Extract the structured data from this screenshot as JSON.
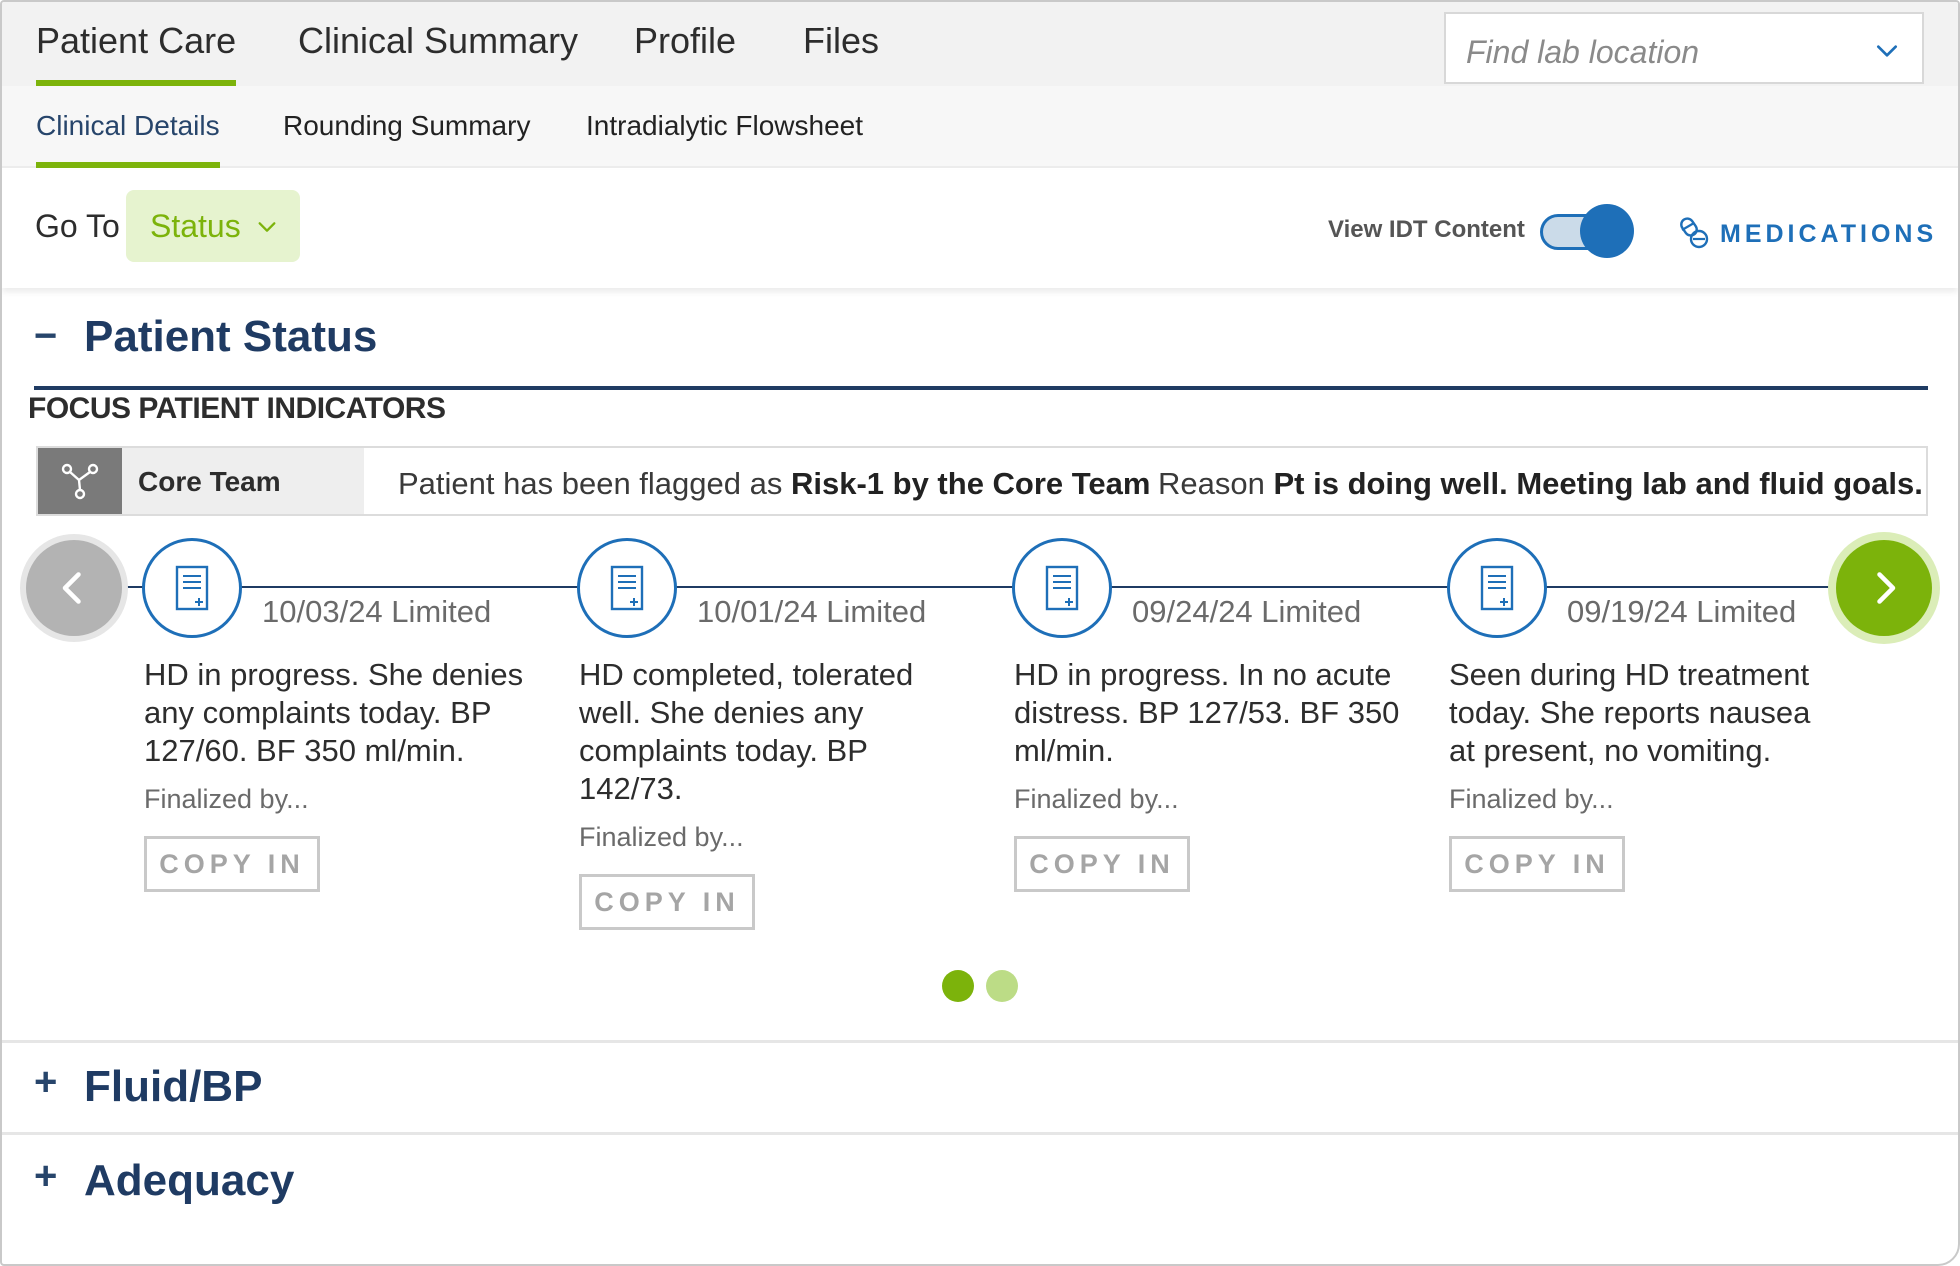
{
  "top_tabs": [
    "Patient Care",
    "Clinical Summary",
    "Profile",
    "Files"
  ],
  "lab_select": {
    "placeholder": "Find lab location"
  },
  "sub_tabs": [
    "Clinical Details",
    "Rounding Summary",
    "Intradialytic Flowsheet"
  ],
  "goto": {
    "label": "Go To",
    "selected": "Status"
  },
  "idt": {
    "label": "View IDT Content",
    "enabled": true
  },
  "medications": {
    "label": "MEDICATIONS"
  },
  "patient_status": {
    "sign": "−",
    "title": "Patient Status",
    "focus_title": "FOCUS PATIENT INDICATORS",
    "core_team": {
      "label": "Core Team",
      "msg_prefix": "Patient has been flagged as",
      "risk": "Risk-1 by the Core Team",
      "reason_label": "Reason",
      "reason": "Pt is doing well. Meeting lab and fluid goals."
    },
    "notes": [
      {
        "date": "10/03/24 Limited",
        "text": "HD in progress. She denies any complaints today. BP 127/60. BF 350 ml/min.",
        "finalized": "Finalized by...",
        "copy": "COPY IN"
      },
      {
        "date": "10/01/24 Limited",
        "text": "HD completed, tolerated well. She denies any complaints today. BP 142/73.",
        "finalized": "Finalized by...",
        "copy": "COPY IN"
      },
      {
        "date": "09/24/24 Limited",
        "text": "HD in progress. In no acute distress. BP 127/53. BF 350 ml/min.",
        "finalized": "Finalized by...",
        "copy": "COPY IN"
      },
      {
        "date": "09/19/24 Limited",
        "text": "Seen during HD treatment today. She reports nausea at present, no vomiting.",
        "finalized": "Finalized by...",
        "copy": "COPY IN"
      }
    ],
    "pagination": {
      "current": 1,
      "total": 2
    }
  },
  "sections": [
    {
      "sign": "+",
      "title": "Fluid/BP"
    },
    {
      "sign": "+",
      "title": "Adequacy"
    }
  ],
  "colors": {
    "accent_green": "#7cb30b",
    "brand_blue": "#1e6fb8",
    "heading_navy": "#1f3b63"
  },
  "icons": {
    "lab_select": "chevron-down-icon",
    "status": "chevron-down-icon",
    "medications": "pills-icon",
    "core_team": "team-network-icon",
    "note": "document-plus-icon",
    "prev": "chevron-left-icon",
    "next": "chevron-right-icon"
  }
}
